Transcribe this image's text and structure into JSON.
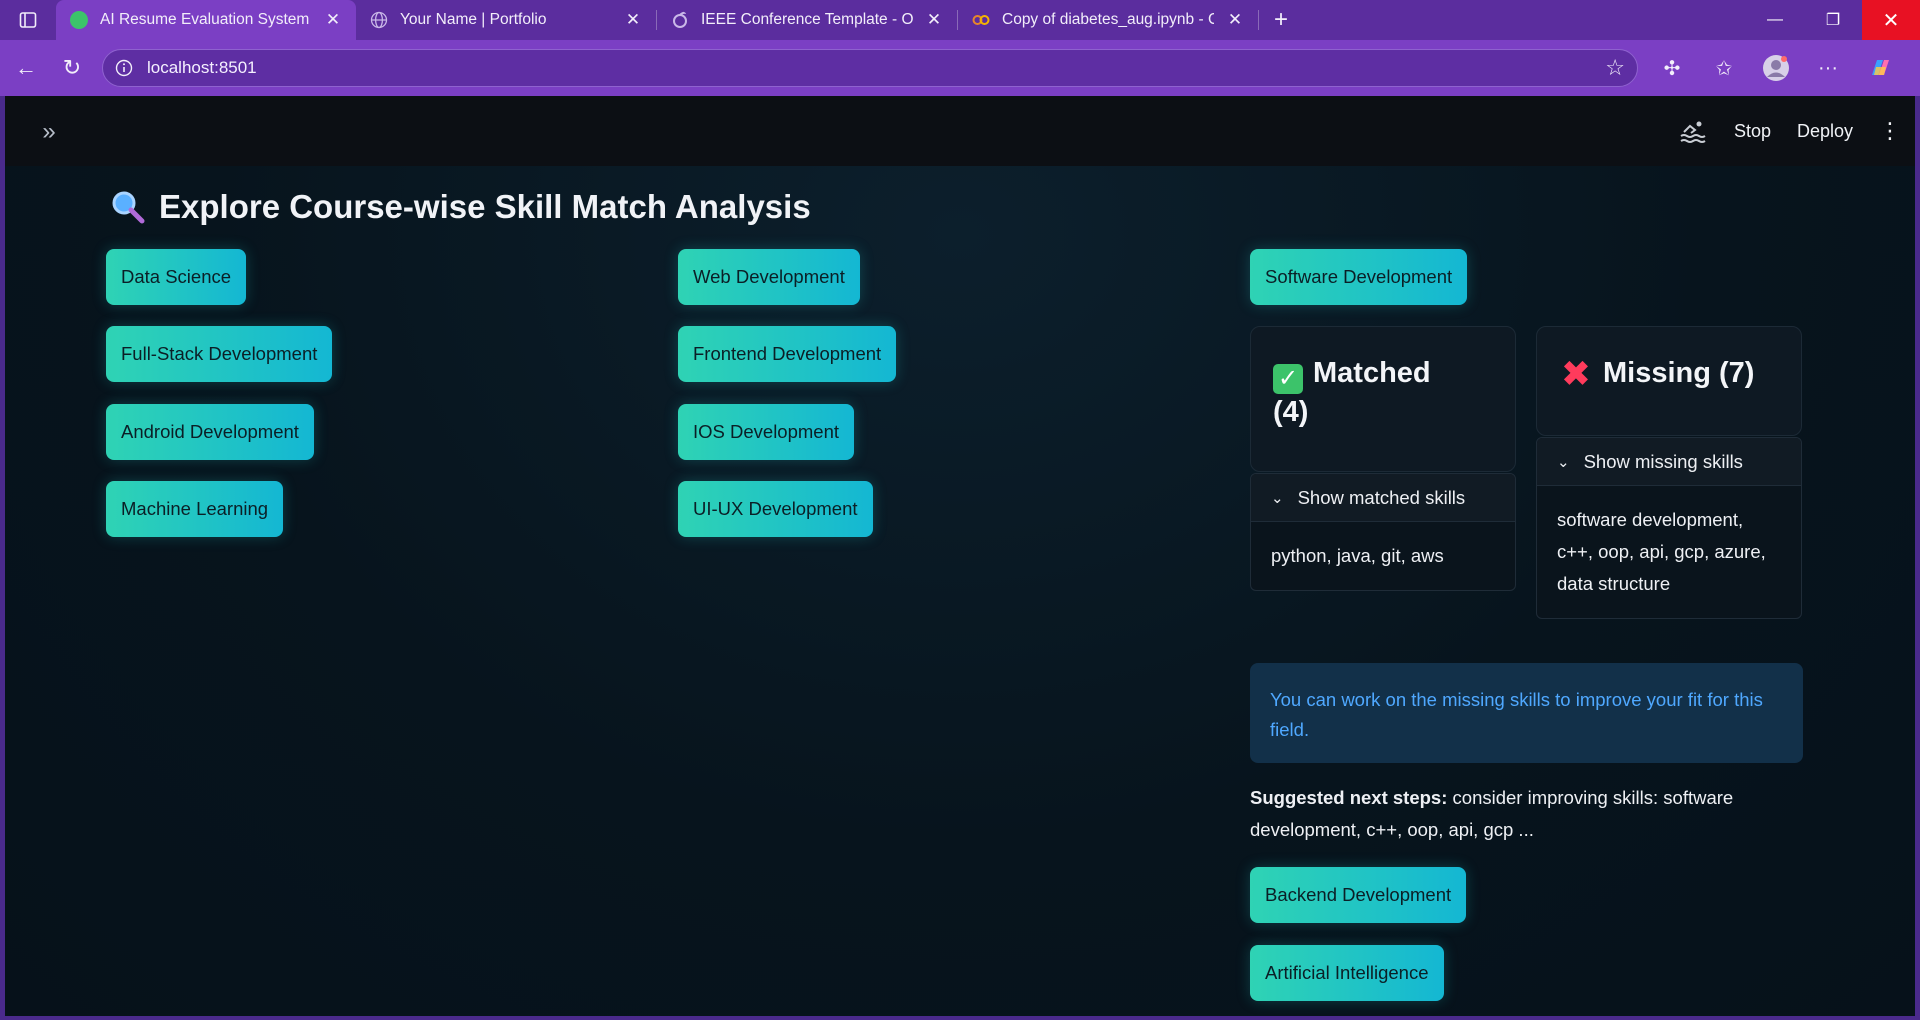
{
  "browser": {
    "tabs": [
      {
        "title": "AI Resume Evaluation System",
        "favicon_color": "#3cc36a",
        "active": true
      },
      {
        "title": "Your Name | Portfolio",
        "favicon_color": "#8a6ab8",
        "active": false
      },
      {
        "title": "IEEE Conference Template - Online",
        "favicon_color": "#8a6ab8",
        "active": false
      },
      {
        "title": "Copy of diabetes_aug.ipynb - Colab",
        "favicon_color": "#e8862a",
        "active": false
      }
    ],
    "url": "localhost:8501"
  },
  "app_header": {
    "stop_label": "Stop",
    "deploy_label": "Deploy"
  },
  "page": {
    "title": "Explore Course-wise Skill Match Analysis",
    "courses": [
      "Data Science",
      "Web Development",
      "Software Development",
      "Full-Stack Development",
      "Frontend Development",
      "Android Development",
      "IOS Development",
      "Machine Learning",
      "UI-UX Development",
      "Backend Development",
      "Artificial Intelligence"
    ],
    "matched": {
      "label": "Matched",
      "count": "(4)",
      "expander_label": "Show matched skills",
      "skills": "python, java, git, aws"
    },
    "missing": {
      "label": "Missing (7)",
      "expander_label": "Show missing skills",
      "skills": "software development, c++, oop, api, gcp, azure, data structure"
    },
    "info_message": "You can work on the missing skills to improve your fit for this field.",
    "next_steps_label": "Suggested next steps:",
    "next_steps_text": "consider improving skills: software development, c++, oop, api, gcp ..."
  },
  "colors": {
    "accent_gradient_start": "#2fd3b4",
    "accent_gradient_end": "#14b7d3",
    "info_text": "#4fa8ff",
    "browser_chrome": "#7b3fc4"
  }
}
